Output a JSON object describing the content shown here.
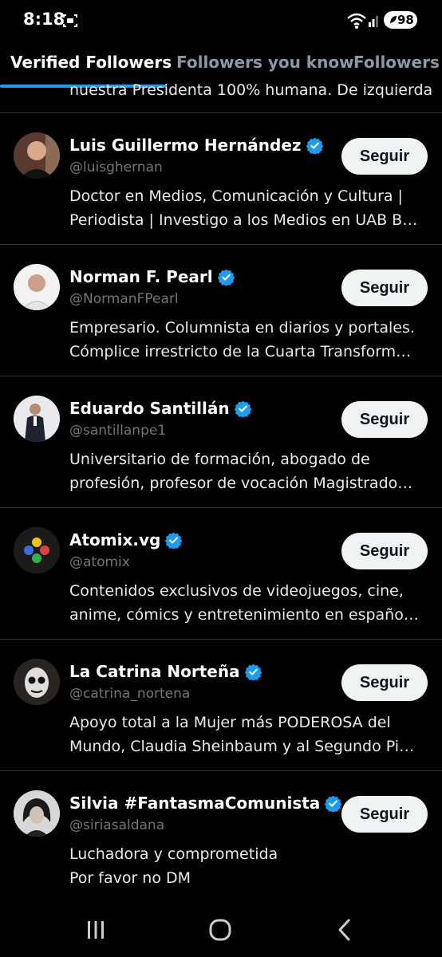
{
  "status_bar": {
    "time": "8:18",
    "battery": "98"
  },
  "tabs": [
    {
      "label": "Verified Followers",
      "active": true
    },
    {
      "label": "Followers you know",
      "active": false
    },
    {
      "label": "Followers",
      "active": false
    }
  ],
  "peek_text": "nuestra Presidenta 100% humana. De izquierda",
  "follow_label": "Seguir",
  "users": [
    {
      "name": "Luis Guillermo Hernández",
      "handle": "@luisghernan",
      "bio": [
        "Doctor en Medios, Comunicación y Cultura |",
        "Periodista | Investigo a los Medios en UAB B…"
      ]
    },
    {
      "name": "Norman F. Pearl",
      "handle": "@NormanFPearl",
      "bio": [
        "Empresario. Columnista en diarios y portales.",
        "Cómplice irrestricto de la Cuarta Transform…"
      ]
    },
    {
      "name": "Eduardo Santillán",
      "handle": "@santillanpe1",
      "bio": [
        "Universitario de formación, abogado de",
        "profesión, profesor de vocación Magistrado…"
      ]
    },
    {
      "name": "Atomix.vg",
      "handle": "@atomix",
      "bio": [
        "Contenidos exclusivos de videojuegos, cine,",
        "anime, cómics y entretenimiento en españo…"
      ]
    },
    {
      "name": "La Catrina Norteña",
      "handle": "@catrina_nortena",
      "bio": [
        "Apoyo total a la Mujer más PODEROSA del",
        "Mundo, Claudia Sheinbaum y al Segundo Pi…"
      ]
    },
    {
      "name": "Silvia #FantasmaComunista",
      "handle": "@siriasaldana",
      "bio": [
        "Luchadora y comprometida",
        "Por favor no DM"
      ]
    }
  ],
  "colors": {
    "background": "#000000",
    "accent": "#1d9bf0",
    "text_secondary": "#71767b",
    "button_bg": "#eff3f4"
  },
  "icons": {
    "verified": "verified-badge-icon",
    "nav_recents": "recents-icon",
    "nav_home": "home-icon",
    "nav_back": "back-icon"
  }
}
